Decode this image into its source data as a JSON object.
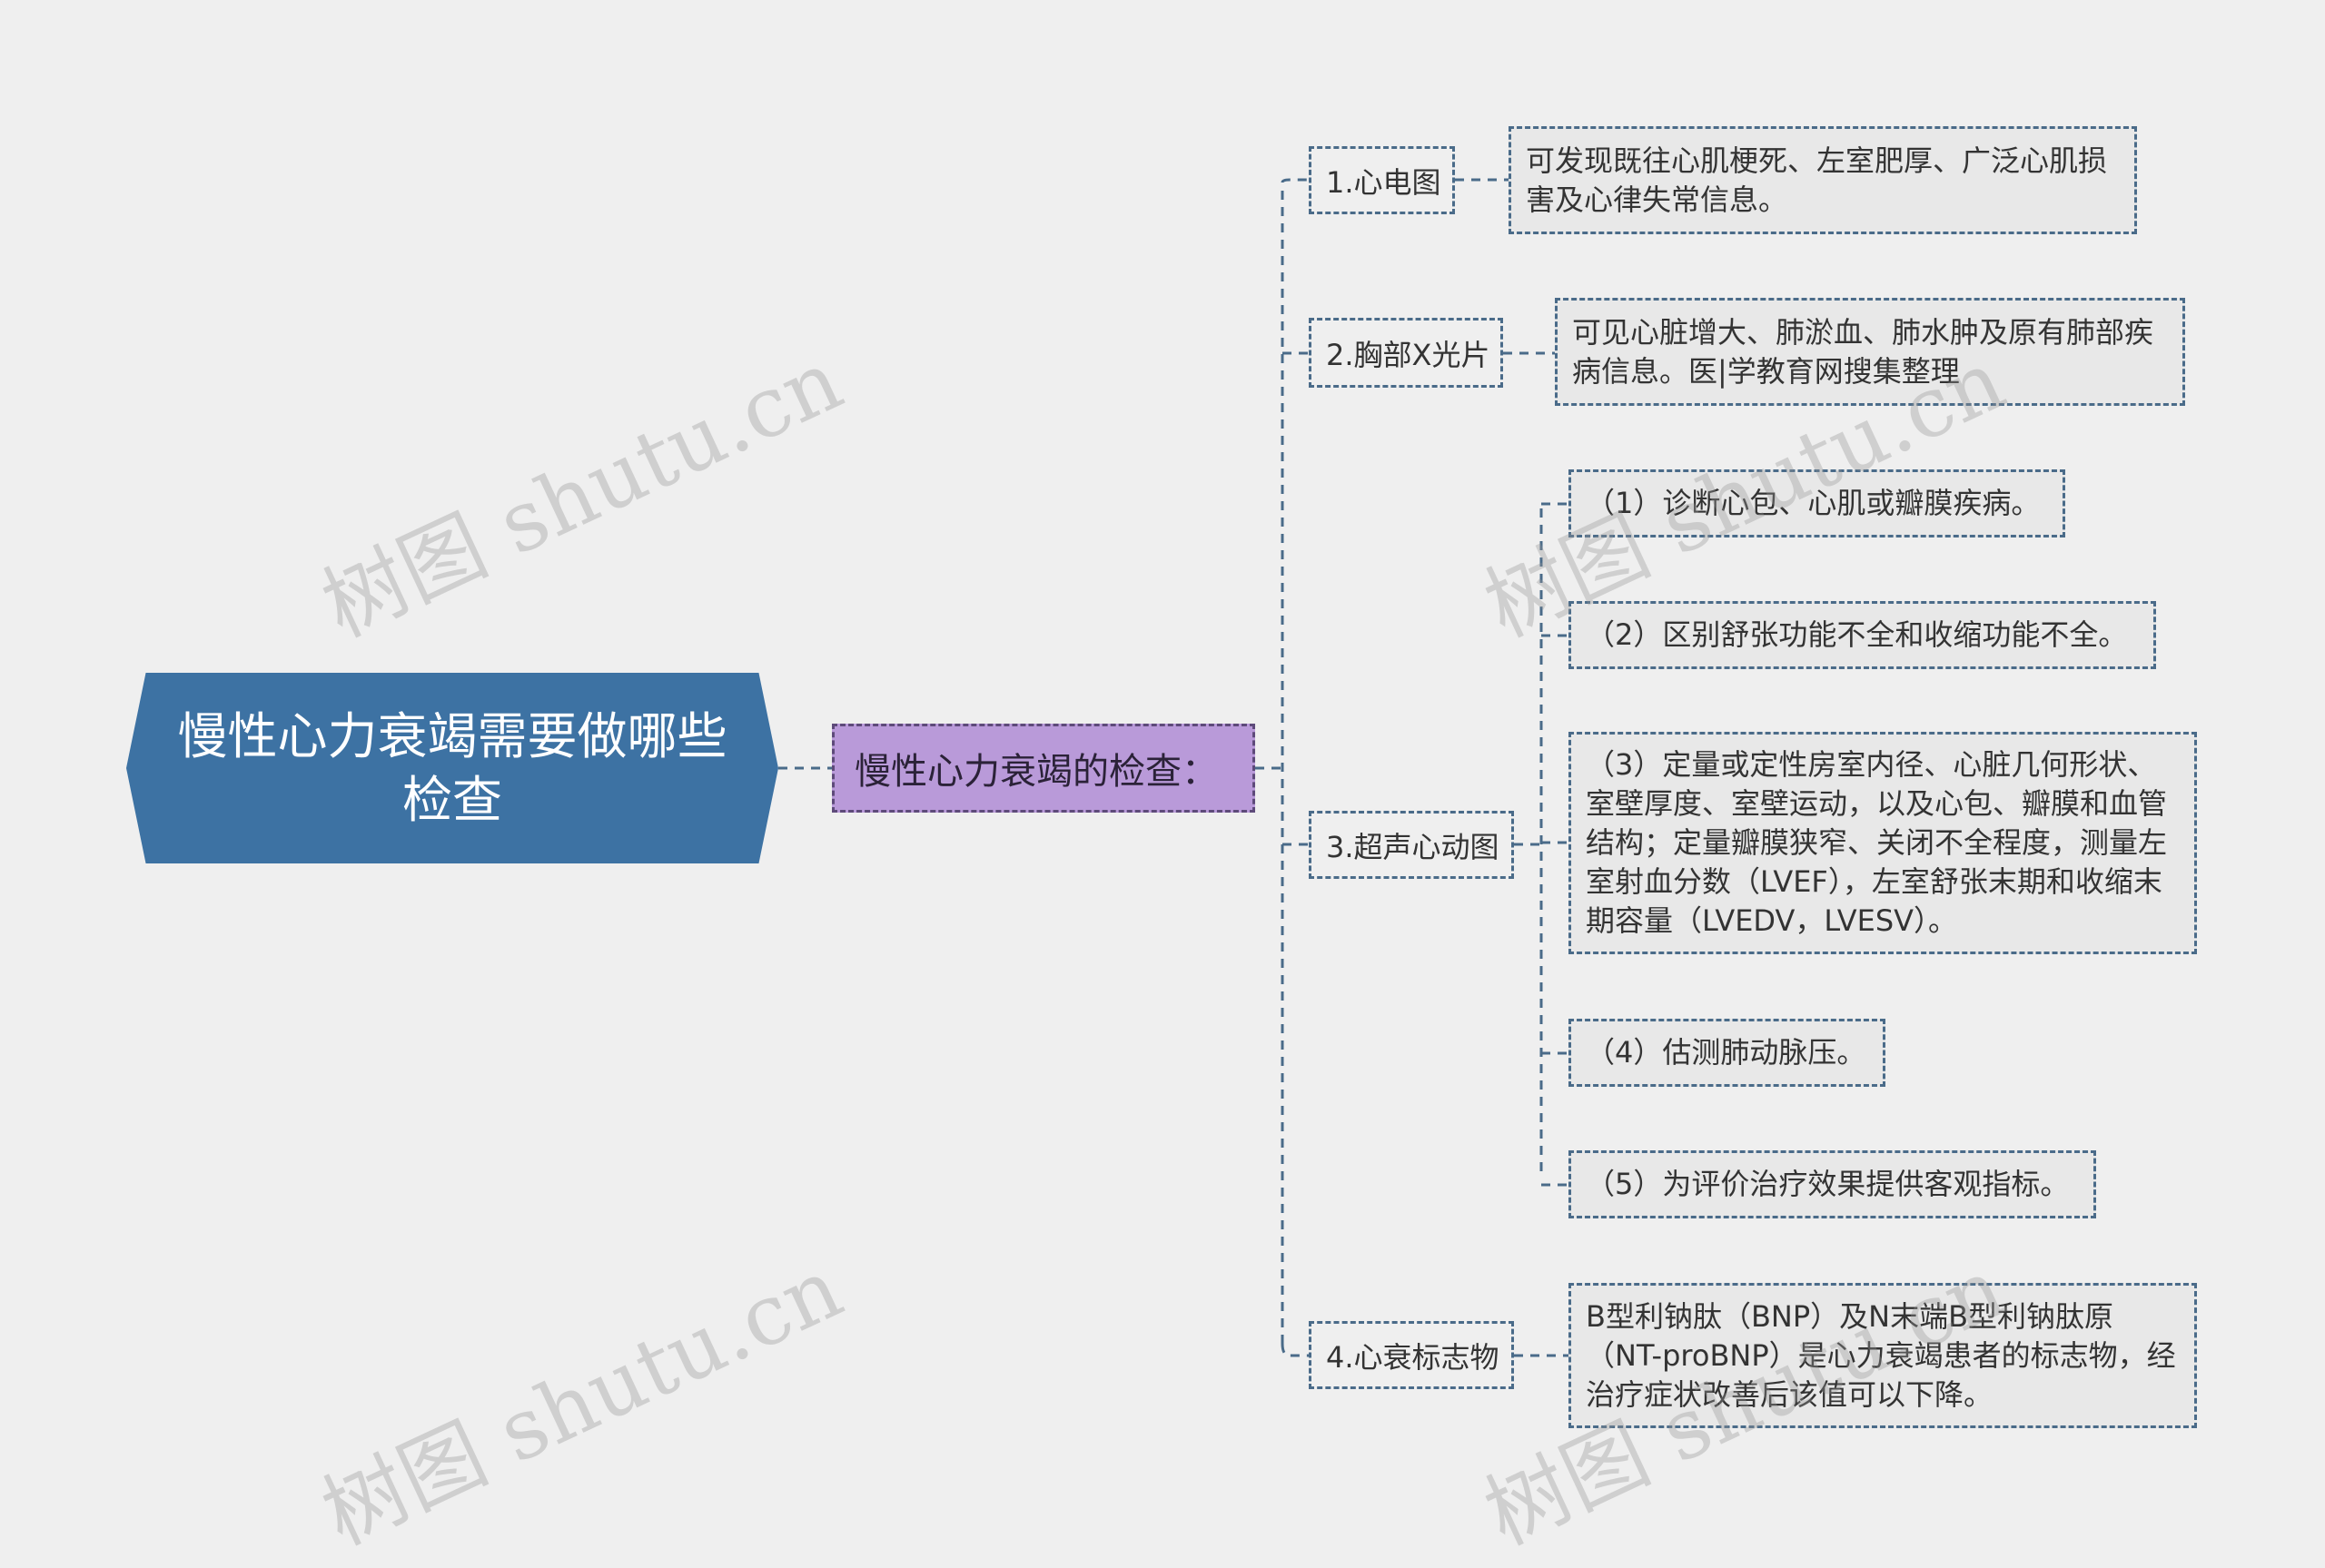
{
  "root": {
    "title": "慢性心力衰竭需要做哪些检查"
  },
  "sub": {
    "title": "慢性心力衰竭的检查："
  },
  "branches": [
    {
      "label": "1.心电图",
      "leaves": [
        "可发现既往心肌梗死、左室肥厚、广泛心肌损害及心律失常信息。"
      ]
    },
    {
      "label": "2.胸部X光片",
      "leaves": [
        "可见心脏增大、肺淤血、肺水肿及原有肺部疾病信息。医|学教育网搜集整理"
      ]
    },
    {
      "label": "3.超声心动图",
      "leaves": [
        "（1）诊断心包、心肌或瓣膜疾病。",
        "（2）区别舒张功能不全和收缩功能不全。",
        "（3）定量或定性房室内径、心脏几何形状、室壁厚度、室壁运动，以及心包、瓣膜和血管结构；定量瓣膜狭窄、关闭不全程度，测量左室射血分数（LVEF），左室舒张末期和收缩末期容量（LVEDV，LVESV）。",
        "（4）估测肺动脉压。",
        "（5）为评价治疗效果提供客观指标。"
      ]
    },
    {
      "label": "4.心衰标志物",
      "leaves": [
        "B型利钠肽（BNP）及N末端B型利钠肽原（NT-proBNP）是心力衰竭患者的标志物，经治疗症状改善后该值可以下降。"
      ]
    }
  ],
  "watermark": "树图 shutu.cn",
  "colors": {
    "root": "#3d72a3",
    "sub": "#b99ad9",
    "line": "#4a6b89",
    "background": "#efefef"
  }
}
